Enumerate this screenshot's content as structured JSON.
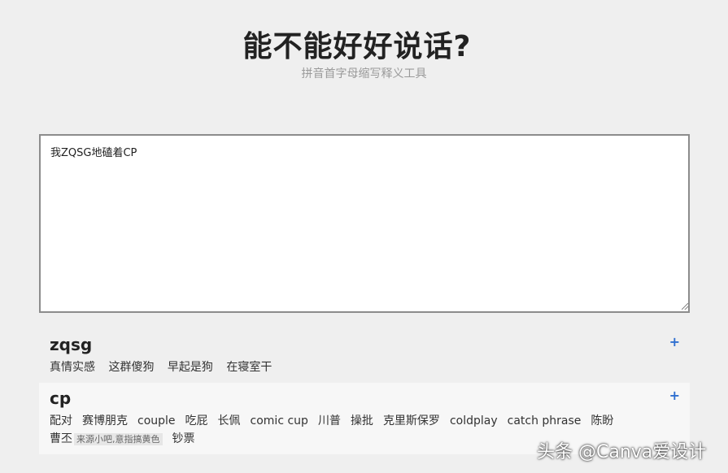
{
  "header": {
    "title": "能不能好好说话?",
    "subtitle": "拼音首字母缩写释义工具"
  },
  "input": {
    "value": "我ZQSG地磕着CP"
  },
  "results": [
    {
      "abbr": "zqsg",
      "add_label": "+",
      "meanings": [
        "真情实感",
        "这群傻狗",
        "早起是狗",
        "在寝室干"
      ]
    },
    {
      "abbr": "cp",
      "add_label": "+",
      "meanings": [
        "配对",
        "赛博朋克",
        "couple",
        "吃屁",
        "长佩",
        "comic cup",
        "川普",
        "操批",
        "克里斯保罗",
        "coldplay",
        "catch phrase",
        "陈盼",
        "曹丕",
        "钞票"
      ],
      "note": "来源小吧,意指搞黄色"
    }
  ],
  "watermark": "头条 @Canva爱设计"
}
